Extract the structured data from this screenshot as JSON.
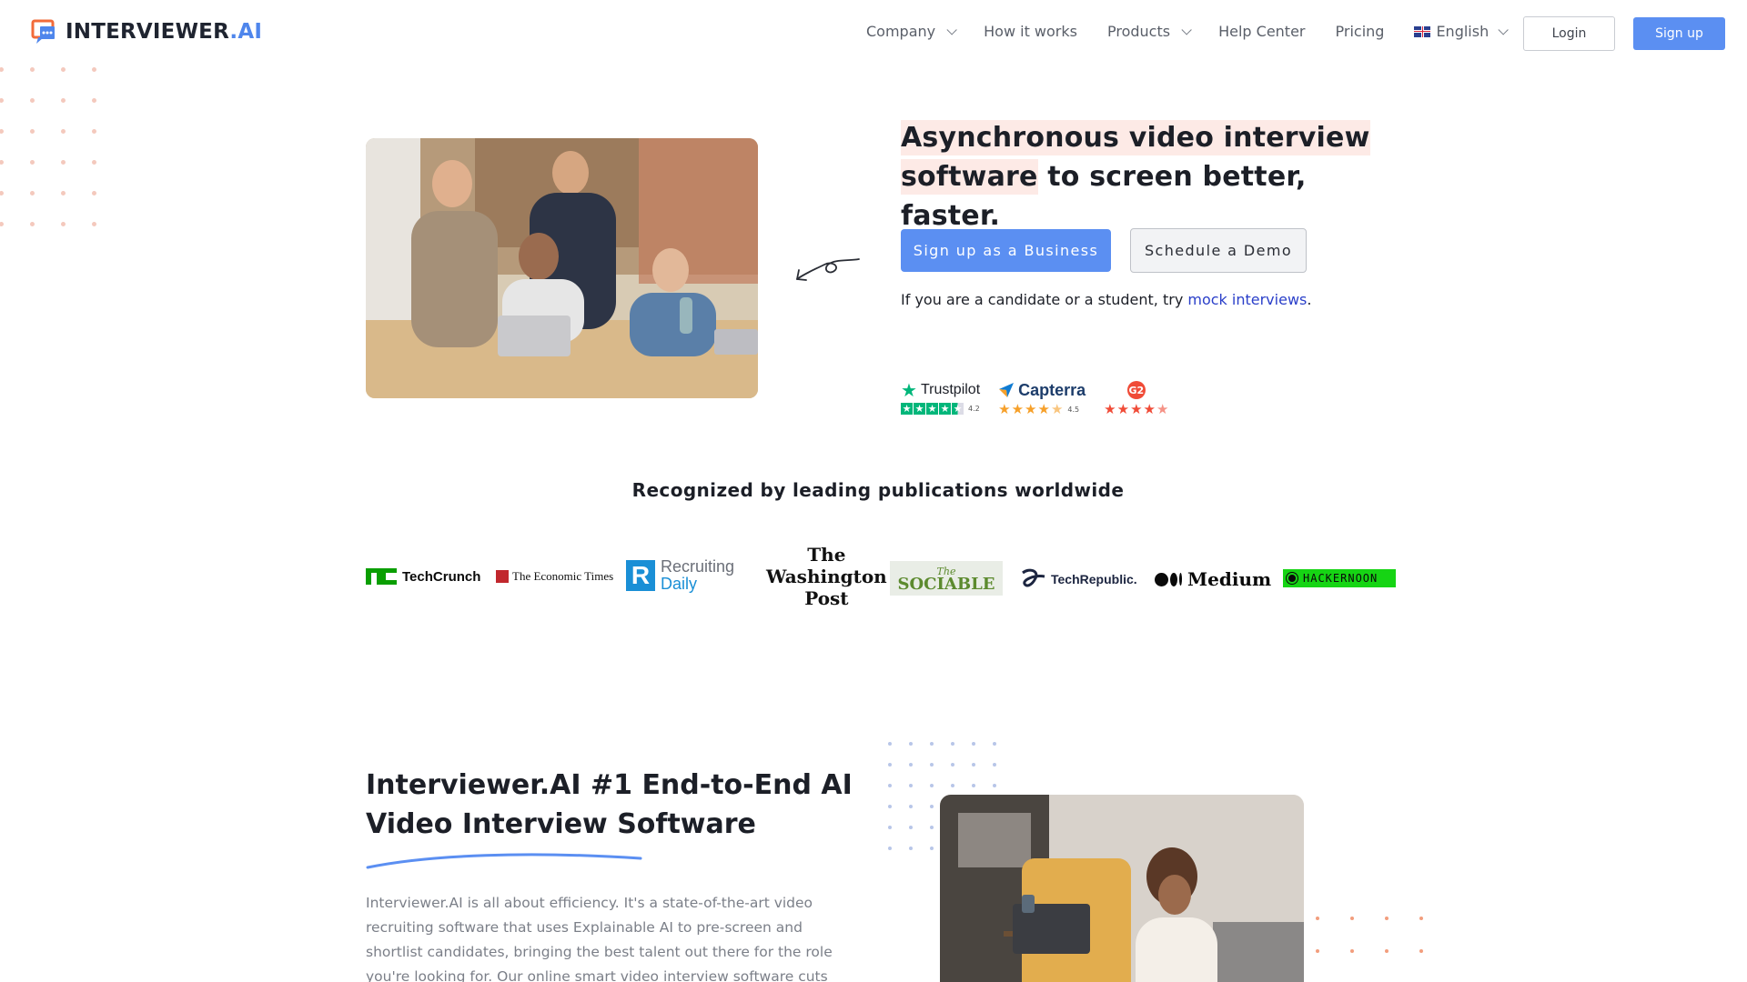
{
  "header": {
    "logo_main": "INTERVIEWER",
    "logo_accent": ".AI",
    "nav": {
      "company": "Company",
      "how_it_works": "How it works",
      "products": "Products",
      "help_center": "Help Center",
      "pricing": "Pricing",
      "language": "English"
    },
    "login": "Login",
    "signup": "Sign up"
  },
  "hero": {
    "title_highlight_1": "Asynchronous video interview",
    "title_highlight_2": "software",
    "title_rest": " to screen better, faster.",
    "btn_business": "Sign up as a Business",
    "btn_demo": "Schedule a Demo",
    "candidate_prefix": "If you are a candidate or a student, try ",
    "candidate_link": "mock interviews",
    "candidate_suffix": "."
  },
  "reviews": {
    "trustpilot": {
      "name": "Trustpilot",
      "score": "4.2"
    },
    "capterra": {
      "name": "Capterra",
      "score": "4.5"
    },
    "g2": {
      "name": "G2"
    }
  },
  "publications": {
    "title": "Recognized by leading publications worldwide",
    "techcrunch": "TechCrunch",
    "economic_times": "The Economic Times",
    "recruiting_1": "Recruiting",
    "recruiting_2": "Daily",
    "wapo_1": "The",
    "wapo_2": "Washington",
    "wapo_3": "Post",
    "sociable_the": "The",
    "sociable": "SOCIABLE",
    "techrepublic": "TechRepublic.",
    "medium": "Medium",
    "hackernoon": "HACKERNOON"
  },
  "section2": {
    "title": "Interviewer.AI #1 End-to-End AI Video Interview Software",
    "body": "Interviewer.AI is all about efficiency. It's a state-of-the-art video recruiting software that uses Explainable AI to pre-screen and shortlist candidates, bringing the best talent out there for the role you're looking for. Our online smart video interview software cuts"
  },
  "colors": {
    "brand_blue": "#5b8ff2",
    "logo_orange": "#f26b3a",
    "highlight": "#fdeae6",
    "link": "#2a3fc9",
    "trustpilot_green": "#00b67a",
    "capterra_star": "#f6a02a",
    "g2_red": "#f04b37"
  },
  "icons": {
    "logo": "chat-bubble-logo-icon",
    "dropdown": "chevron-down-icon",
    "flag": "uk-flag-icon",
    "doodle": "curly-arrow-icon",
    "star": "star-icon"
  }
}
